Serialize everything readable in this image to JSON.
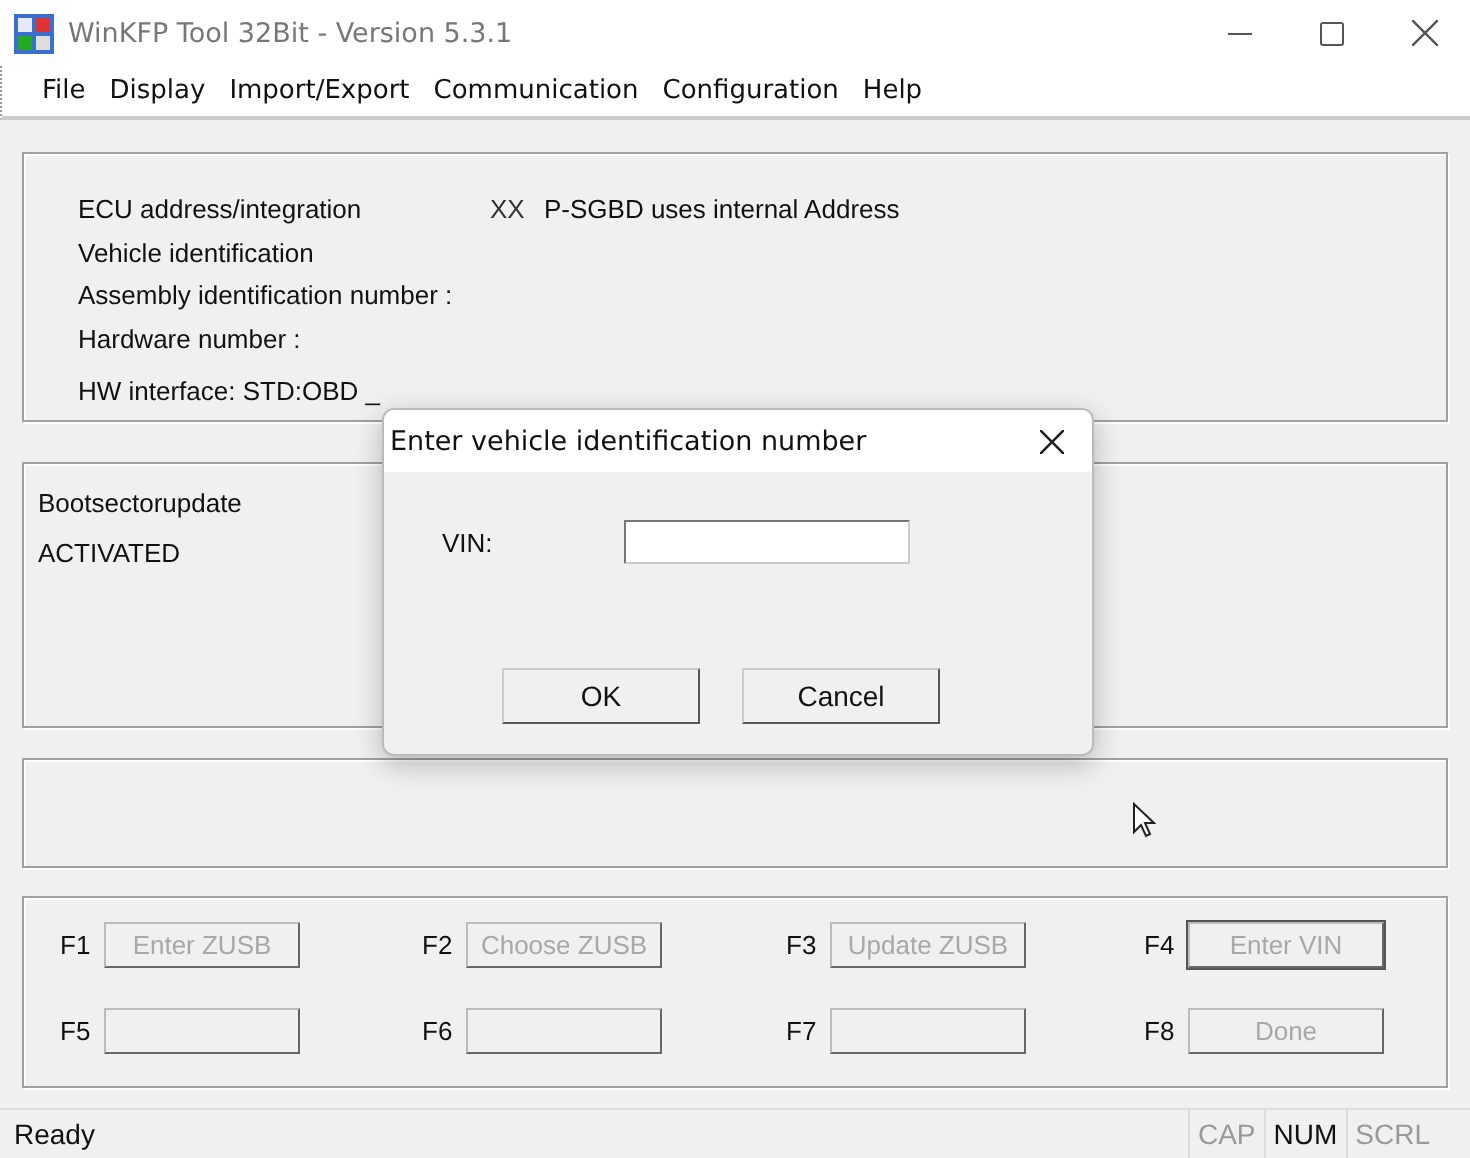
{
  "window": {
    "title": "WinKFP Tool 32Bit - Version 5.3.1"
  },
  "menu": [
    "File",
    "Display",
    "Import/Export",
    "Communication",
    "Configuration",
    "Help"
  ],
  "info_panel": {
    "rows": [
      {
        "label": "ECU address/integration",
        "value": "XX",
        "note": "P-SGBD uses internal Address"
      },
      {
        "label": "Vehicle identification"
      },
      {
        "label": "Assembly identification number :"
      },
      {
        "label": "Hardware number :"
      },
      {
        "label": "HW interface:  STD:OBD _",
        "kind": "spaced"
      }
    ]
  },
  "status_panel": {
    "lines": [
      "Bootsectorupdate",
      "ACTIVATED"
    ]
  },
  "function_keys": [
    {
      "key": "F1",
      "label": "Enter ZUSB",
      "disabled": true,
      "focused": false
    },
    {
      "key": "F2",
      "label": "Choose ZUSB",
      "disabled": true,
      "focused": false
    },
    {
      "key": "F3",
      "label": "Update ZUSB",
      "disabled": true,
      "focused": false
    },
    {
      "key": "F4",
      "label": "Enter VIN",
      "disabled": true,
      "focused": true
    },
    {
      "key": "F5",
      "focused": false
    },
    {
      "key": "F6",
      "focused": false
    },
    {
      "key": "F7",
      "focused": false
    },
    {
      "key": "F8",
      "label": "Done",
      "disabled": true,
      "focused": false
    }
  ],
  "dialog": {
    "title": "Enter vehicle identification number",
    "fields": [
      {
        "label": "VIN:"
      }
    ],
    "buttons": [
      "OK",
      "Cancel"
    ]
  },
  "status_bar": {
    "text": "Ready",
    "indicators": [
      {
        "label": "CAP",
        "on": false
      },
      {
        "label": "NUM",
        "on": true
      },
      {
        "label": "SCRL",
        "on": false
      }
    ]
  }
}
